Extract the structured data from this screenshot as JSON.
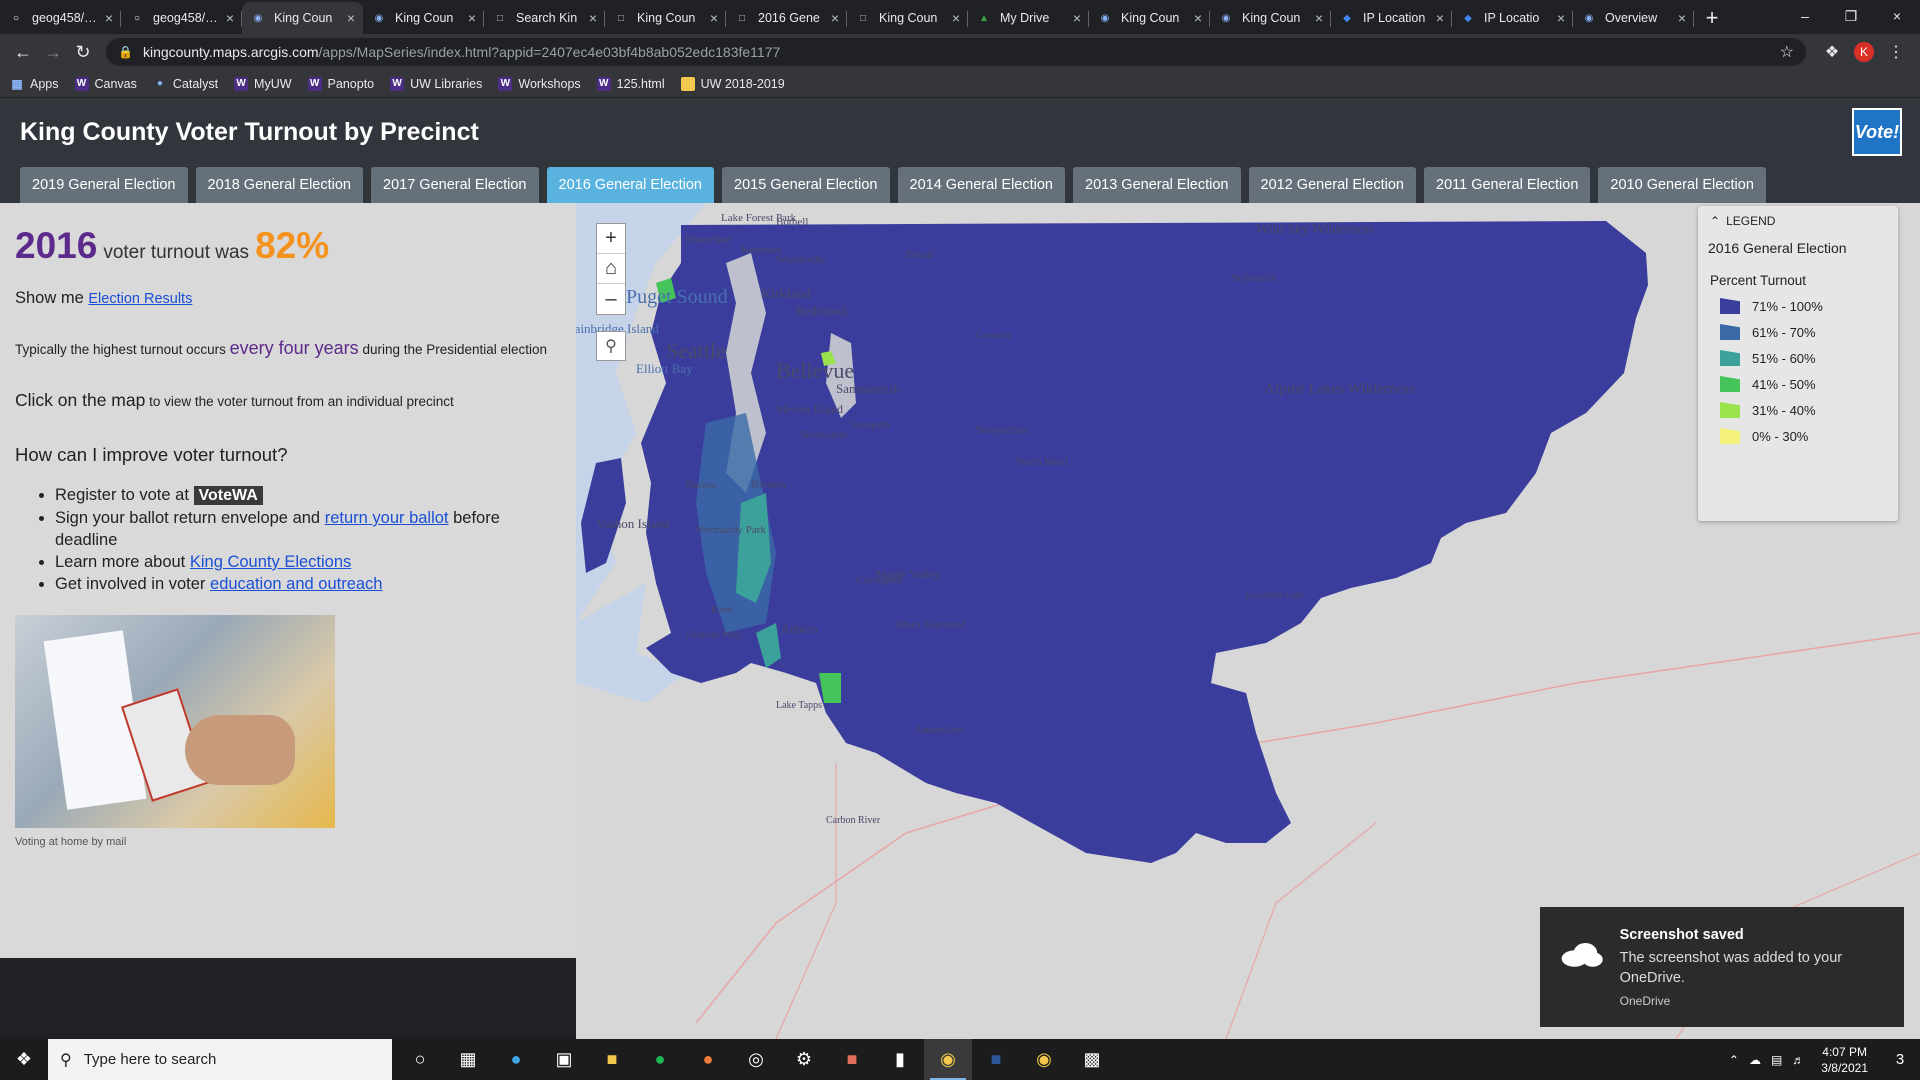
{
  "browser": {
    "tabs": [
      {
        "label": "geog458/…",
        "icon": "github-icon",
        "active": false
      },
      {
        "label": "geog458/…",
        "icon": "github-icon",
        "active": false
      },
      {
        "label": "King Coun",
        "icon": "arcgis-icon",
        "active": true
      },
      {
        "label": "King Coun",
        "icon": "arcgis-icon",
        "active": false
      },
      {
        "label": "Search Kin",
        "icon": "page-icon",
        "active": false
      },
      {
        "label": "King Coun",
        "icon": "page-icon",
        "active": false
      },
      {
        "label": "2016 Gene",
        "icon": "page-icon",
        "active": false
      },
      {
        "label": "King Coun",
        "icon": "page-icon",
        "active": false
      },
      {
        "label": "My Drive",
        "icon": "drive-icon",
        "active": false
      },
      {
        "label": "King Coun",
        "icon": "arcgis-icon",
        "active": false
      },
      {
        "label": "King Coun",
        "icon": "arcgis-icon",
        "active": false
      },
      {
        "label": "IP Location",
        "icon": "ip-icon",
        "active": false
      },
      {
        "label": "IP Locatio",
        "icon": "ip-icon",
        "active": false
      },
      {
        "label": "Overview",
        "icon": "arcgis-icon",
        "active": false
      }
    ],
    "url_host": "kingcounty.maps.arcgis.com",
    "url_path": "/apps/MapSeries/index.html?appid=2407ec4e03bf4b8ab052edc183fe1177",
    "profile_initial": "K",
    "bookmarks": [
      {
        "label": "Apps",
        "icon": "apps-grid-icon"
      },
      {
        "label": "Canvas",
        "icon": "w-icon"
      },
      {
        "label": "Catalyst",
        "icon": "catalyst-icon"
      },
      {
        "label": "MyUW",
        "icon": "w-icon"
      },
      {
        "label": "Panopto",
        "icon": "w-icon"
      },
      {
        "label": "UW Libraries",
        "icon": "w-icon"
      },
      {
        "label": "Workshops",
        "icon": "w-icon"
      },
      {
        "label": "125.html",
        "icon": "w-icon"
      },
      {
        "label": "UW 2018-2019",
        "icon": "folder-icon"
      }
    ]
  },
  "app": {
    "title": "King County Voter Turnout by Precinct",
    "logo_text": "Vote!",
    "election_tabs": [
      {
        "label": "2019 General Election",
        "active": false
      },
      {
        "label": "2018 General Election",
        "active": false
      },
      {
        "label": "2017 General Election",
        "active": false
      },
      {
        "label": "2016 General Election",
        "active": true
      },
      {
        "label": "2015 General Election",
        "active": false
      },
      {
        "label": "2014 General Election",
        "active": false
      },
      {
        "label": "2013 General Election",
        "active": false
      },
      {
        "label": "2012 General Election",
        "active": false
      },
      {
        "label": "2011 General Election",
        "active": false
      },
      {
        "label": "2010 General Election",
        "active": false
      }
    ]
  },
  "panel": {
    "year": "2016",
    "turnout_text": "voter turnout was",
    "turnout_pct": "82%",
    "show_me": "Show me",
    "election_results_link": "Election Results",
    "typical_pre": "Typically the highest turnout occurs",
    "typical_hl": "every four years",
    "typical_post": "during the Presidential election",
    "click_bold": "Click on the map",
    "click_rest": "to view the voter turnout from an individual precinct",
    "how_heading": "How can I improve voter turnout?",
    "list": {
      "register_pre": "Register to vote at",
      "votewa": "VoteWA",
      "sign_pre": "Sign your ballot return envelope and",
      "sign_link": "return your ballot",
      "sign_post": "before deadline",
      "learn_pre": "Learn more about",
      "learn_link": "King County Elections",
      "involved_pre": "Get involved in voter",
      "involved_link": "education and outreach"
    },
    "photo_caption": "Voting at home by mail"
  },
  "legend": {
    "header": "LEGEND",
    "title": "2016 General Election",
    "subtitle": "Percent Turnout",
    "items": [
      {
        "label": "71% - 100%",
        "color": "#3a3d9c"
      },
      {
        "label": "61% - 70%",
        "color": "#3b6aa8"
      },
      {
        "label": "51% - 60%",
        "color": "#3ba19a"
      },
      {
        "label": "41% - 50%",
        "color": "#44c45a"
      },
      {
        "label": "31% - 40%",
        "color": "#9be34d"
      },
      {
        "label": "0% - 30%",
        "color": "#f4f27a"
      }
    ]
  },
  "map": {
    "labels": [
      "Seattle",
      "Bellevue",
      "Kirkland",
      "Redmond",
      "Sammamish",
      "Issaquah",
      "Renton",
      "Kent",
      "Auburn",
      "Maple Valley",
      "Black Diamond",
      "Enumclaw",
      "Vashon Island",
      "North Bend",
      "Snoqualmie",
      "Shoreline",
      "Kenmore",
      "Woodinville",
      "Duvall",
      "Carnation",
      "Skykomish",
      "Alpine Lakes Wilderness",
      "Wild Sky Wilderness",
      "Covington",
      "Bainbridge Island",
      "Puget Sound",
      "Elliott Bay",
      "Lake Tapps",
      "Mercer Island",
      "Newcastle",
      "Burien",
      "Normandy Park",
      "Federal Way",
      "Keechelus Lake",
      "Carbon River",
      "Lake Forest Park",
      "Bothell"
    ]
  },
  "toast": {
    "title": "Screenshot saved",
    "body": "The screenshot was added to your OneDrive.",
    "source": "OneDrive"
  },
  "taskbar": {
    "search_placeholder": "Type here to search",
    "time": "4:07 PM",
    "date": "3/8/2021",
    "notification_count": "3"
  }
}
